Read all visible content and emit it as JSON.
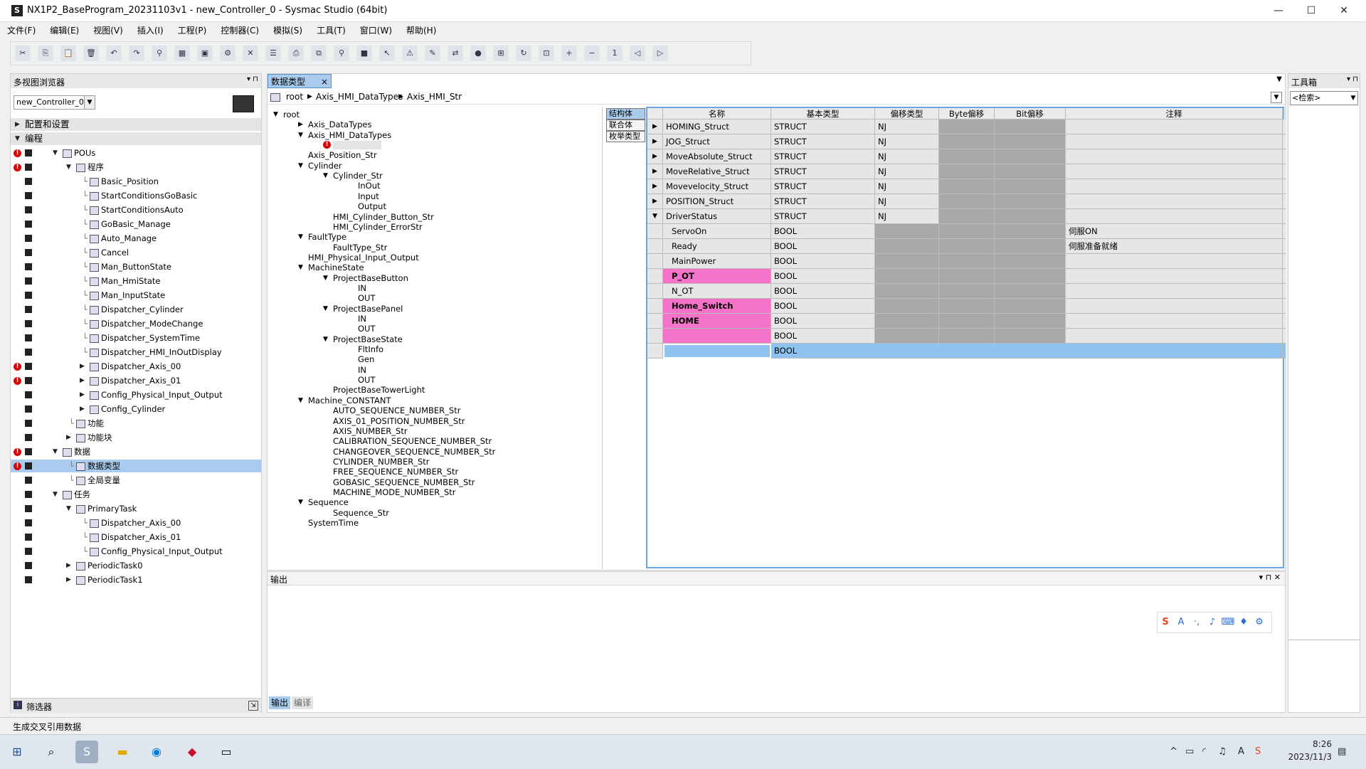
{
  "window": {
    "title": "NX1P2_BaseProgram_20231103v1 - new_Controller_0 - Sysmac Studio (64bit)",
    "icon_letter": "S",
    "min": "—",
    "max": "☐",
    "close": "✕"
  },
  "menu": [
    "文件(F)",
    "编辑(E)",
    "视图(V)",
    "插入(I)",
    "工程(P)",
    "控制器(C)",
    "模拟(S)",
    "工具(T)",
    "窗口(W)",
    "帮助(H)"
  ],
  "toolbar_icons": [
    "cut-icon",
    "copy-icon",
    "paste-icon",
    "delete-icon",
    "undo-icon",
    "redo-icon",
    "find-icon",
    "build-icon",
    "window-icon",
    "settings-icon",
    "cross-icon",
    "list-icon",
    "print-icon",
    "network-icon",
    "search-icon",
    "stop-icon",
    "cursor-icon",
    "warning-icon",
    "pencil-icon",
    "transfer-icon",
    "online-icon",
    "io-icon",
    "refresh-icon",
    "fit-icon",
    "zoom-in-icon",
    "zoom-out-icon",
    "zoom-reset-icon",
    "back-icon",
    "forward-icon"
  ],
  "left_panel": {
    "title": "多视图浏览器",
    "controller": "new_Controller_0",
    "filter_label": "筛选器",
    "tree": [
      {
        "label": "配置和设置",
        "indent": 0,
        "tri": "▶",
        "band": true,
        "err": false,
        "sq": false,
        "icon": false
      },
      {
        "label": "编程",
        "indent": 0,
        "tri": "▼",
        "band": true,
        "err": false,
        "sq": false,
        "icon": false
      },
      {
        "label": "POUs",
        "indent": 1,
        "tri": "▼",
        "err": true,
        "sq": true,
        "icon": true
      },
      {
        "label": "程序",
        "indent": 2,
        "tri": "▼",
        "err": true,
        "sq": true,
        "icon": true
      },
      {
        "label": "Basic_Position",
        "indent": 3,
        "tri": "",
        "err": false,
        "sq": true,
        "icon": true
      },
      {
        "label": "StartConditionsGoBasic",
        "indent": 3,
        "tri": "",
        "err": false,
        "sq": true,
        "icon": true
      },
      {
        "label": "StartConditionsAuto",
        "indent": 3,
        "tri": "",
        "err": false,
        "sq": true,
        "icon": true
      },
      {
        "label": "GoBasic_Manage",
        "indent": 3,
        "tri": "",
        "err": false,
        "sq": true,
        "icon": true
      },
      {
        "label": "Auto_Manage",
        "indent": 3,
        "tri": "",
        "err": false,
        "sq": true,
        "icon": true
      },
      {
        "label": "Cancel",
        "indent": 3,
        "tri": "",
        "err": false,
        "sq": true,
        "icon": true
      },
      {
        "label": "Man_ButtonState",
        "indent": 3,
        "tri": "",
        "err": false,
        "sq": true,
        "icon": true
      },
      {
        "label": "Man_HmiState",
        "indent": 3,
        "tri": "",
        "err": false,
        "sq": true,
        "icon": true
      },
      {
        "label": "Man_InputState",
        "indent": 3,
        "tri": "",
        "err": false,
        "sq": true,
        "icon": true
      },
      {
        "label": "Dispatcher_Cylinder",
        "indent": 3,
        "tri": "",
        "err": false,
        "sq": true,
        "icon": true
      },
      {
        "label": "Dispatcher_ModeChange",
        "indent": 3,
        "tri": "",
        "err": false,
        "sq": true,
        "icon": true
      },
      {
        "label": "Dispatcher_SystemTime",
        "indent": 3,
        "tri": "",
        "err": false,
        "sq": true,
        "icon": true
      },
      {
        "label": "Dispatcher_HMI_InOutDisplay",
        "indent": 3,
        "tri": "",
        "err": false,
        "sq": true,
        "icon": true
      },
      {
        "label": "Dispatcher_Axis_00",
        "indent": 3,
        "tri": "▶",
        "err": true,
        "sq": true,
        "icon": true
      },
      {
        "label": "Dispatcher_Axis_01",
        "indent": 3,
        "tri": "▶",
        "err": true,
        "sq": true,
        "icon": true
      },
      {
        "label": "Config_Physical_Input_Output",
        "indent": 3,
        "tri": "▶",
        "err": false,
        "sq": true,
        "icon": true
      },
      {
        "label": "Config_Cylinder",
        "indent": 3,
        "tri": "▶",
        "err": false,
        "sq": true,
        "icon": true
      },
      {
        "label": "功能",
        "indent": 2,
        "tri": "",
        "err": false,
        "sq": true,
        "icon": true
      },
      {
        "label": "功能块",
        "indent": 2,
        "tri": "▶",
        "err": false,
        "sq": true,
        "icon": true
      },
      {
        "label": "数据",
        "indent": 1,
        "tri": "▼",
        "err": true,
        "sq": true,
        "icon": true
      },
      {
        "label": "数据类型",
        "indent": 2,
        "tri": "",
        "err": true,
        "sq": true,
        "icon": true,
        "sel": true
      },
      {
        "label": "全局变量",
        "indent": 2,
        "tri": "",
        "err": false,
        "sq": true,
        "icon": true
      },
      {
        "label": "任务",
        "indent": 1,
        "tri": "▼",
        "err": false,
        "sq": true,
        "icon": true
      },
      {
        "label": "PrimaryTask",
        "indent": 2,
        "tri": "▼",
        "err": false,
        "sq": true,
        "icon": true
      },
      {
        "label": "Dispatcher_Axis_00",
        "indent": 3,
        "tri": "",
        "err": false,
        "sq": true,
        "icon": true
      },
      {
        "label": "Dispatcher_Axis_01",
        "indent": 3,
        "tri": "",
        "err": false,
        "sq": true,
        "icon": true
      },
      {
        "label": "Config_Physical_Input_Output",
        "indent": 3,
        "tri": "",
        "err": false,
        "sq": true,
        "icon": true
      },
      {
        "label": "PeriodicTask0",
        "indent": 2,
        "tri": "▶",
        "err": false,
        "sq": true,
        "icon": true
      },
      {
        "label": "PeriodicTask1",
        "indent": 2,
        "tri": "▶",
        "err": false,
        "sq": true,
        "icon": true
      }
    ]
  },
  "editor": {
    "tab": "数据类型",
    "breadcrumb": [
      "root",
      "Axis_HMI_DataTypes",
      "Axis_HMI_Str"
    ],
    "kinds": [
      "结构体",
      "联合体",
      "枚举类型"
    ],
    "type_tree": [
      {
        "label": "root",
        "indent": 0,
        "tri": "▼"
      },
      {
        "label": "Axis_DataTypes",
        "indent": 1,
        "tri": "▶"
      },
      {
        "label": "Axis_HMI_DataTypes",
        "indent": 1,
        "tri": "▼"
      },
      {
        "label": "",
        "indent": 2,
        "tri": "",
        "err": true
      },
      {
        "label": "Axis_Position_Str",
        "indent": 1,
        "tri": ""
      },
      {
        "label": "Cylinder",
        "indent": 1,
        "tri": "▼"
      },
      {
        "label": "Cylinder_Str",
        "indent": 2,
        "tri": "▼"
      },
      {
        "label": "InOut",
        "indent": 3,
        "tri": ""
      },
      {
        "label": "Input",
        "indent": 3,
        "tri": ""
      },
      {
        "label": "Output",
        "indent": 3,
        "tri": ""
      },
      {
        "label": "HMI_Cylinder_Button_Str",
        "indent": 2,
        "tri": ""
      },
      {
        "label": "HMI_Cylinder_ErrorStr",
        "indent": 2,
        "tri": ""
      },
      {
        "label": "FaultType",
        "indent": 1,
        "tri": "▼"
      },
      {
        "label": "FaultType_Str",
        "indent": 2,
        "tri": ""
      },
      {
        "label": "HMI_Physical_Input_Output",
        "indent": 1,
        "tri": ""
      },
      {
        "label": "MachineState",
        "indent": 1,
        "tri": "▼"
      },
      {
        "label": "ProjectBaseButton",
        "indent": 2,
        "tri": "▼"
      },
      {
        "label": "IN",
        "indent": 3,
        "tri": ""
      },
      {
        "label": "OUT",
        "indent": 3,
        "tri": ""
      },
      {
        "label": "ProjectBasePanel",
        "indent": 2,
        "tri": "▼"
      },
      {
        "label": "IN",
        "indent": 3,
        "tri": ""
      },
      {
        "label": "OUT",
        "indent": 3,
        "tri": ""
      },
      {
        "label": "ProjectBaseState",
        "indent": 2,
        "tri": "▼"
      },
      {
        "label": "FltInfo",
        "indent": 3,
        "tri": ""
      },
      {
        "label": "Gen",
        "indent": 3,
        "tri": ""
      },
      {
        "label": "IN",
        "indent": 3,
        "tri": ""
      },
      {
        "label": "OUT",
        "indent": 3,
        "tri": ""
      },
      {
        "label": "ProjectBaseTowerLight",
        "indent": 2,
        "tri": ""
      },
      {
        "label": "Machine_CONSTANT",
        "indent": 1,
        "tri": "▼"
      },
      {
        "label": "AUTO_SEQUENCE_NUMBER_Str",
        "indent": 2,
        "tri": ""
      },
      {
        "label": "AXIS_01_POSITION_NUMBER_Str",
        "indent": 2,
        "tri": ""
      },
      {
        "label": "AXIS_NUMBER_Str",
        "indent": 2,
        "tri": ""
      },
      {
        "label": "CALIBRATION_SEQUENCE_NUMBER_Str",
        "indent": 2,
        "tri": ""
      },
      {
        "label": "CHANGEOVER_SEQUENCE_NUMBER_Str",
        "indent": 2,
        "tri": ""
      },
      {
        "label": "CYLINDER_NUMBER_Str",
        "indent": 2,
        "tri": ""
      },
      {
        "label": "FREE_SEQUENCE_NUMBER_Str",
        "indent": 2,
        "tri": ""
      },
      {
        "label": "GOBASIC_SEQUENCE_NUMBER_Str",
        "indent": 2,
        "tri": ""
      },
      {
        "label": "MACHINE_MODE_NUMBER_Str",
        "indent": 2,
        "tri": ""
      },
      {
        "label": "Sequence",
        "indent": 1,
        "tri": "▼"
      },
      {
        "label": "Sequence_Str",
        "indent": 2,
        "tri": ""
      },
      {
        "label": "SystemTime",
        "indent": 1,
        "tri": ""
      }
    ],
    "columns": [
      "名称",
      "基本类型",
      "偏移类型",
      "Byte偏移",
      "Bit偏移",
      "注释"
    ],
    "rows": [
      {
        "expander": "▶",
        "name": "HOMING_Struct",
        "type": "STRUCT",
        "offset": "NJ",
        "byte": "",
        "bit": "",
        "comment": "",
        "level": 0,
        "hl": false
      },
      {
        "expander": "▶",
        "name": "JOG_Struct",
        "type": "STRUCT",
        "offset": "NJ",
        "byte": "",
        "bit": "",
        "comment": "",
        "level": 0,
        "hl": false
      },
      {
        "expander": "▶",
        "name": "MoveAbsolute_Struct",
        "type": "STRUCT",
        "offset": "NJ",
        "byte": "",
        "bit": "",
        "comment": "",
        "level": 0,
        "hl": false
      },
      {
        "expander": "▶",
        "name": "MoveRelative_Struct",
        "type": "STRUCT",
        "offset": "NJ",
        "byte": "",
        "bit": "",
        "comment": "",
        "level": 0,
        "hl": false
      },
      {
        "expander": "▶",
        "name": "Movevelocity_Struct",
        "type": "STRUCT",
        "offset": "NJ",
        "byte": "",
        "bit": "",
        "comment": "",
        "level": 0,
        "hl": false
      },
      {
        "expander": "▶",
        "name": "POSITION_Struct",
        "type": "STRUCT",
        "offset": "NJ",
        "byte": "",
        "bit": "",
        "comment": "",
        "level": 0,
        "hl": false
      },
      {
        "expander": "▼",
        "name": "DriverStatus",
        "type": "STRUCT",
        "offset": "NJ",
        "byte": "",
        "bit": "",
        "comment": "",
        "level": 0,
        "hl": false
      },
      {
        "expander": "",
        "name": "ServoOn",
        "type": "BOOL",
        "offset": "",
        "byte": "",
        "bit": "",
        "comment": "伺服ON",
        "level": 1,
        "hl": false
      },
      {
        "expander": "",
        "name": "Ready",
        "type": "BOOL",
        "offset": "",
        "byte": "",
        "bit": "",
        "comment": "伺服准备就绪",
        "level": 1,
        "hl": false
      },
      {
        "expander": "",
        "name": "MainPower",
        "type": "BOOL",
        "offset": "",
        "byte": "",
        "bit": "",
        "comment": "",
        "level": 1,
        "hl": false
      },
      {
        "expander": "",
        "name": "P_OT",
        "type": "BOOL",
        "offset": "",
        "byte": "",
        "bit": "",
        "comment": "",
        "level": 1,
        "hl": true
      },
      {
        "expander": "",
        "name": "N_OT",
        "type": "BOOL",
        "offset": "",
        "byte": "",
        "bit": "",
        "comment": "",
        "level": 1,
        "hl": false
      },
      {
        "expander": "",
        "name": "Home_Switch",
        "type": "BOOL",
        "offset": "",
        "byte": "",
        "bit": "",
        "comment": "",
        "level": 1,
        "hl": true
      },
      {
        "expander": "",
        "name": "HOME",
        "type": "BOOL",
        "offset": "",
        "byte": "",
        "bit": "",
        "comment": "",
        "level": 1,
        "hl": true
      },
      {
        "expander": "",
        "name": "",
        "type": "BOOL",
        "offset": "",
        "byte": "",
        "bit": "",
        "comment": "",
        "level": 1,
        "hl": true
      },
      {
        "expander": "",
        "name": "",
        "type": "BOOL",
        "offset": "",
        "byte": "",
        "bit": "",
        "comment": "",
        "level": 1,
        "hl": false,
        "selected": true
      }
    ]
  },
  "output_pane": {
    "title": "输出",
    "tabs": [
      "输出",
      "编译"
    ]
  },
  "toolbox": {
    "title": "工具箱",
    "search_placeholder": "<检索>"
  },
  "statusbar": {
    "text": "生成交叉引用数据"
  },
  "taskbar": {
    "time": "8:26",
    "date": "2023/11/3",
    "ime": "A"
  },
  "colors": {
    "highlight": "#f472c8",
    "selection": "#a9cbee",
    "grid_border": "#6aa6e0",
    "disabled_cell": "#a8a8a8"
  }
}
